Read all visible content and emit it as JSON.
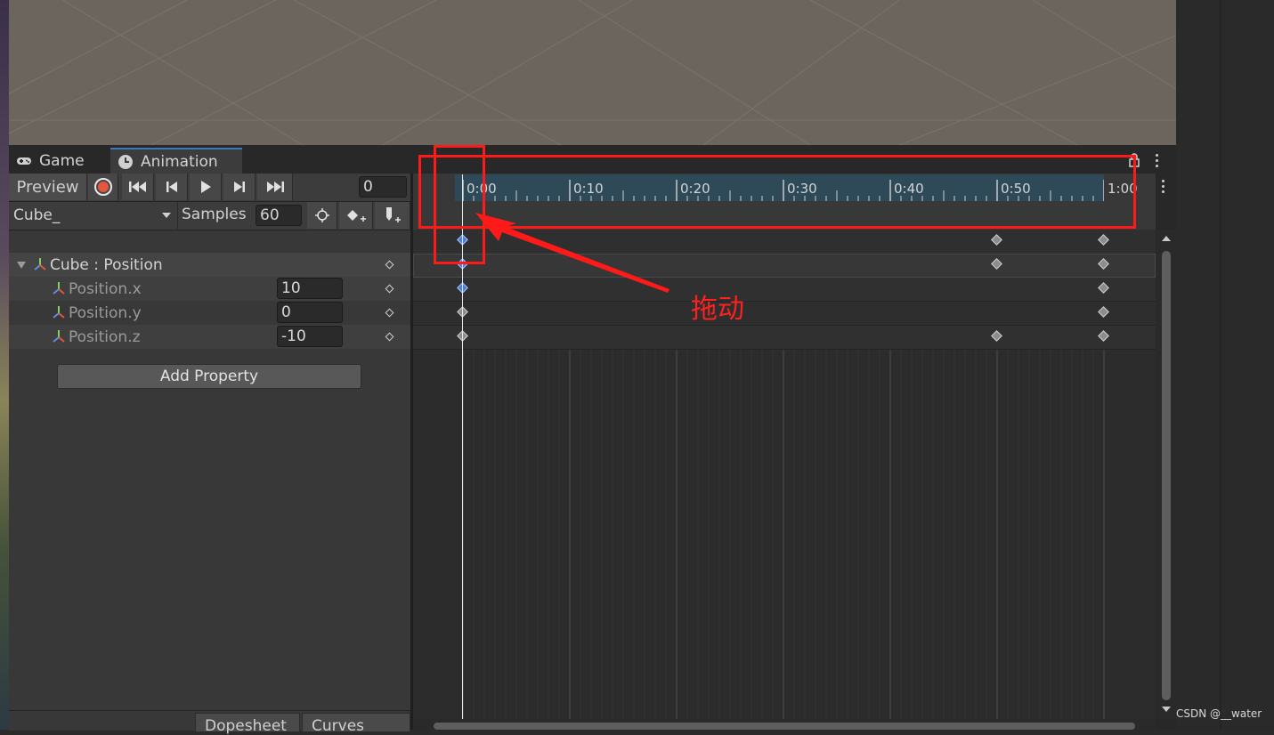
{
  "tabs": [
    {
      "label": "Game",
      "icon": "gamepad-icon"
    },
    {
      "label": "Animation",
      "icon": "clock-icon"
    }
  ],
  "toolbar": {
    "preview_label": "Preview",
    "frame_value": "0",
    "clip_name": "Cube_",
    "samples_label": "Samples",
    "samples_value": "60"
  },
  "properties": {
    "group_label": "Cube : Position",
    "items": [
      {
        "label": "Position.x",
        "value": "10"
      },
      {
        "label": "Position.y",
        "value": "0"
      },
      {
        "label": "Position.z",
        "value": "-10"
      }
    ]
  },
  "add_property_label": "Add Property",
  "bottom_tabs": {
    "dopesheet": "Dopesheet",
    "curves": "Curves"
  },
  "timeline": {
    "ticks": [
      "0:00",
      "0:10",
      "0:20",
      "0:30",
      "0:40",
      "0:50",
      "1:00"
    ],
    "playhead_time": "0:00",
    "keyframes": {
      "summary": [
        "0:00",
        "0:50",
        "1:00"
      ],
      "group": [
        "0:00",
        "0:50",
        "1:00"
      ],
      "position_x": [
        "0:00",
        "1:00"
      ],
      "position_y": [
        "0:00",
        "1:00"
      ],
      "position_z": [
        "0:00",
        "0:50",
        "1:00"
      ]
    }
  },
  "annotation": {
    "text": "拖动",
    "color": "#ff1a1a"
  },
  "watermark": "CSDN @__water",
  "colors": {
    "accent": "#3a79bb",
    "record": "#e5563c",
    "selected_key": "#4d7fd1",
    "ruler": "#2e4a59"
  }
}
